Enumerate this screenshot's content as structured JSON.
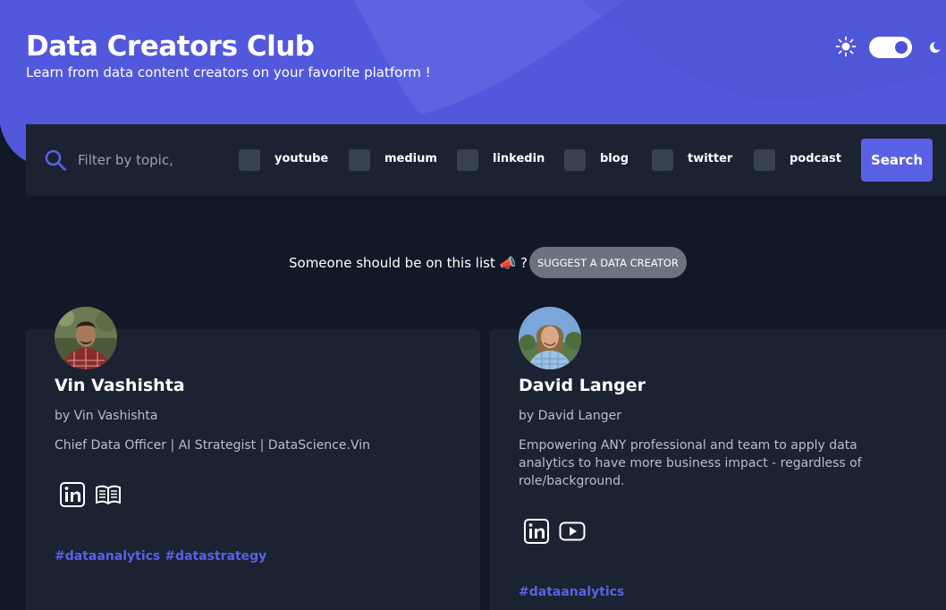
{
  "header": {
    "title": "Data Creators Club",
    "subtitle": "Learn from data content creators on your favorite platform !",
    "accent_color": "#5a60e3"
  },
  "theme": {
    "sun_icon": "sun-icon",
    "moon_icon": "moon-icon",
    "dark_mode_enabled": true
  },
  "filter": {
    "placeholder": "Filter by topic,",
    "value": "",
    "platforms": [
      {
        "label": "youtube",
        "checked": false
      },
      {
        "label": "medium",
        "checked": false
      },
      {
        "label": "linkedin",
        "checked": false
      },
      {
        "label": "blog",
        "checked": false
      },
      {
        "label": "twitter",
        "checked": false
      },
      {
        "label": "podcast",
        "checked": false
      }
    ],
    "search_label": "Search"
  },
  "suggest": {
    "text": "Someone should be on this list 📣 ?",
    "button_label": "SUGGEST A DATA CREATOR"
  },
  "creators": [
    {
      "name": "Vin Vashishta",
      "by": "by Vin Vashishta",
      "description": "Chief Data Officer | AI Strategist | DataScience.Vin",
      "platform_icons": [
        "linkedin-icon",
        "blog-icon"
      ],
      "tags": [
        "#dataanalytics",
        "#datastrategy"
      ]
    },
    {
      "name": "David Langer",
      "by": "by David Langer",
      "description": "Empowering ANY professional and team to apply data analytics to have more business impact - regardless of role/background.",
      "platform_icons": [
        "linkedin-icon",
        "youtube-icon"
      ],
      "tags": [
        "#dataanalytics"
      ]
    }
  ]
}
